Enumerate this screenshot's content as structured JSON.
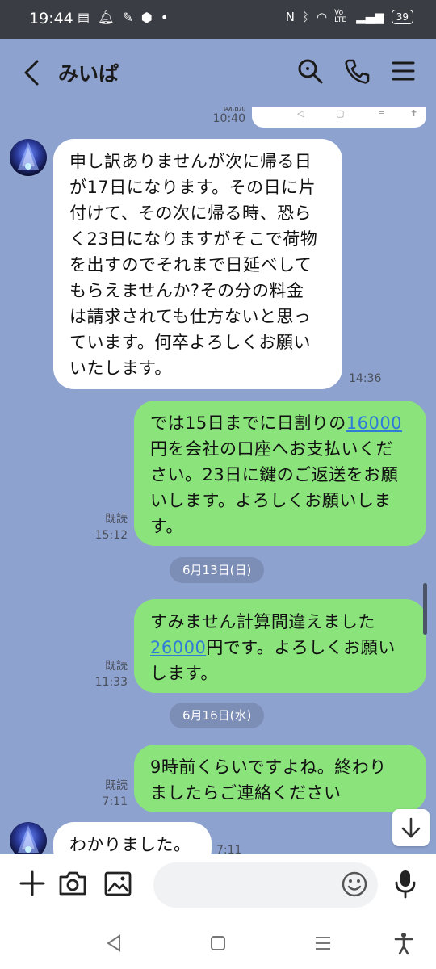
{
  "status_bar": {
    "time": "19:44",
    "battery": "39",
    "network": "Vo LTE"
  },
  "header": {
    "title": "みいぱ"
  },
  "preview": {
    "read": "既読",
    "time": "10:40"
  },
  "messages": [
    {
      "side": "in",
      "text": "申し訳ありませんが次に帰る日が17日になります。その日に片付けて、その次に帰る時、恐らく23日になりますがそこで荷物を出すのでそれまで日延べしてもらえませんか?その分の料金は請求されても仕方ないと思っています。何卒よろしくお願いいたします。",
      "lines": [
        "申し訳ありませんが次に帰る日",
        "が17日になります。その日に片",
        "付けて、その次に帰る時、恐ら",
        "く23日になりますがそこで荷物",
        "を出すのでそれまで日延べして",
        "もらえませんか?その分の料金",
        "は請求されても仕方ないと思っ",
        "ています。何卒よろしくお願い",
        "いたします。"
      ],
      "time": "14:36"
    },
    {
      "side": "out",
      "line1_pre": "では15日までに日割りの",
      "line1_link": "16000",
      "lines_rest": [
        "円を会社の口座へお支払いくだ",
        "さい。23日に鍵のご返送をお願",
        "いします。よろしくお願いしま",
        "す。"
      ],
      "read": "既読",
      "time": "15:12"
    },
    {
      "side": "out",
      "line1": "すみません計算間違えました",
      "line2_link": "26000",
      "line2_post": "円です。よろしくお願い",
      "line3": "します。",
      "read": "既読",
      "time": "11:33"
    },
    {
      "side": "out",
      "lines": [
        "9時前くらいですよね。終わり",
        "ましたらご連絡ください"
      ],
      "read": "既読",
      "time": "7:11"
    },
    {
      "side": "in",
      "text": "わかりました。",
      "time": "7:11"
    }
  ],
  "dates": [
    "6月13日(日)",
    "6月16日(水)"
  ],
  "input": {
    "placeholder": ""
  },
  "colors": {
    "chat_bg": "#8ea2cf",
    "outgoing_bubble": "#8be37c",
    "incoming_bubble": "#ffffff",
    "link": "#2e7bd8",
    "status_bar": "#3a3d43"
  },
  "icons": {
    "header": [
      "back-icon",
      "search-icon",
      "phone-icon",
      "menu-icon"
    ],
    "input": [
      "plus-icon",
      "camera-icon",
      "image-icon",
      "emoji-icon",
      "mic-icon"
    ],
    "system_nav": [
      "nav-back-icon",
      "nav-home-icon",
      "nav-recents-icon",
      "accessibility-icon"
    ]
  }
}
